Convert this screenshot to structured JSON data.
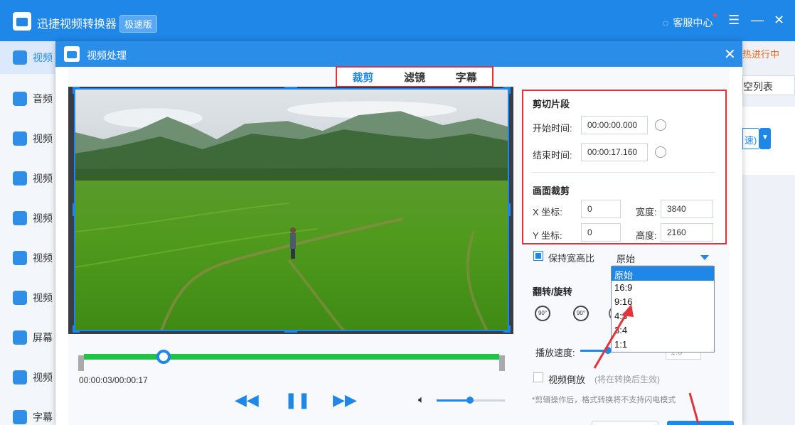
{
  "app": {
    "title": "迅捷视频转换器",
    "badge": "极速版",
    "service": "客服中心",
    "colors": {
      "primary": "#1f87e8",
      "accent": "#e0343a",
      "progress": "#22c248"
    }
  },
  "sidebar": {
    "items": [
      {
        "label": "视频",
        "icon": "video-icon"
      },
      {
        "label": "音频",
        "icon": "audio-icon"
      },
      {
        "label": "视频",
        "icon": "video-convert-icon"
      },
      {
        "label": "视频",
        "icon": "video-merge-icon"
      },
      {
        "label": "视频",
        "icon": "video-split-icon"
      },
      {
        "label": "视频",
        "icon": "video-compress-icon"
      },
      {
        "label": "视频",
        "icon": "video-gif-icon"
      },
      {
        "label": "屏幕",
        "icon": "screen-record-icon"
      },
      {
        "label": "视频",
        "icon": "video-watermark-icon"
      },
      {
        "label": "字幕",
        "icon": "subtitle-icon"
      }
    ]
  },
  "right_edge": {
    "link": "热进行中",
    "clear_list": "空列表",
    "button_text": "速)"
  },
  "dialog": {
    "title": "视频处理",
    "tabs": [
      {
        "label": "裁剪",
        "active": true
      },
      {
        "label": "滤镜",
        "active": false
      },
      {
        "label": "字幕",
        "active": false
      }
    ]
  },
  "player": {
    "time": "00:00:03/00:00:17",
    "progress": 0.2
  },
  "cut": {
    "section_title": "剪切片段",
    "start_label": "开始时间:",
    "start_value": "00:00:00.000",
    "end_label": "结束时间:",
    "end_value": "00:00:17.160"
  },
  "crop": {
    "section_title": "画面裁剪",
    "x_label": "X 坐标:",
    "x_value": "0",
    "y_label": "Y 坐标:",
    "y_value": "0",
    "width_label": "宽度:",
    "width_value": "3840",
    "height_label": "高度:",
    "height_value": "2160"
  },
  "aspect": {
    "label": "保持宽高比",
    "checked": true,
    "selected": "原始",
    "options": [
      "原始",
      "16:9",
      "9:16",
      "4:3",
      "3:4",
      "1:1"
    ]
  },
  "flip": {
    "section_title": "翻转/旋转",
    "rotate_label": "90°"
  },
  "speed": {
    "label": "播放速度:",
    "value": "1.0"
  },
  "reverse": {
    "label": "视频倒放",
    "hint": "(将在转换后生效)",
    "checked": false
  },
  "note": "*剪辑操作后，格式转换将不支持闪电模式"
}
